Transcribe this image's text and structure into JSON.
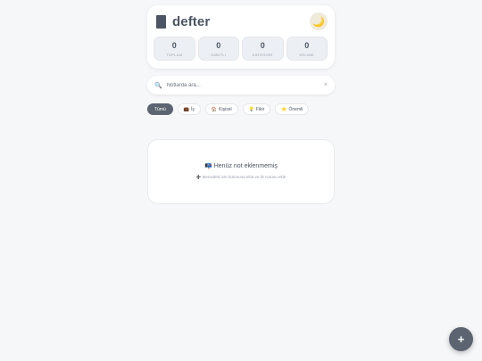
{
  "header": {
    "title": "defter",
    "theme_icon": "🌙"
  },
  "stats": [
    {
      "value": "0",
      "label": "TOPLAM"
    },
    {
      "value": "0",
      "label": "SABITLI"
    },
    {
      "value": "0",
      "label": "KATEGORI"
    },
    {
      "value": "0",
      "label": "KELIME"
    }
  ],
  "search": {
    "icon": "🔍",
    "placeholder": "Notlarda ara...",
    "value": "",
    "clear_icon": "×"
  },
  "filters": [
    {
      "icon": "",
      "label": "Tümü",
      "active": true
    },
    {
      "icon": "💼",
      "label": "İş",
      "active": false
    },
    {
      "icon": "🏠",
      "label": "Kişisel",
      "active": false
    },
    {
      "icon": "💡",
      "label": "Fikir",
      "active": false
    },
    {
      "icon": "⭐",
      "label": "Önemli",
      "active": false
    }
  ],
  "empty_state": {
    "icon": "📭",
    "title": "Henüz not eklenmemiş",
    "hint_icon": "➕",
    "hint": "Mensideki artı butonuna tıkla ve ilk notunu ekle"
  },
  "fab": {
    "label": "+"
  },
  "colors": {
    "accent": "#5b6470",
    "background": "#f6f7f9",
    "card": "#ffffff"
  }
}
